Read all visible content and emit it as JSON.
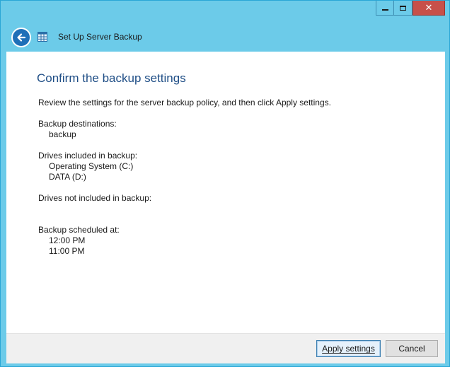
{
  "window": {
    "title": "Set Up Server Backup",
    "controls": {
      "minimize": "minimize-icon",
      "maximize": "maximize-icon",
      "close": "close-icon"
    }
  },
  "page": {
    "heading": "Confirm the backup settings",
    "intro": "Review the settings for the server backup policy, and then click Apply settings.",
    "sections": {
      "destinations_label": "Backup destinations:",
      "destinations": [
        "backup"
      ],
      "included_label": "Drives included in backup:",
      "included": [
        "Operating System (C:)",
        "DATA (D:)"
      ],
      "excluded_label": "Drives not included in backup:",
      "scheduled_label": "Backup scheduled at:",
      "scheduled": [
        "12:00 PM",
        "11:00 PM"
      ]
    }
  },
  "footer": {
    "apply_label": "Apply settings",
    "cancel_label": "Cancel"
  },
  "colors": {
    "chrome": "#6ccbe9",
    "close": "#c7504a",
    "heading": "#1f4e86",
    "back_button": "#1e6fb8"
  }
}
